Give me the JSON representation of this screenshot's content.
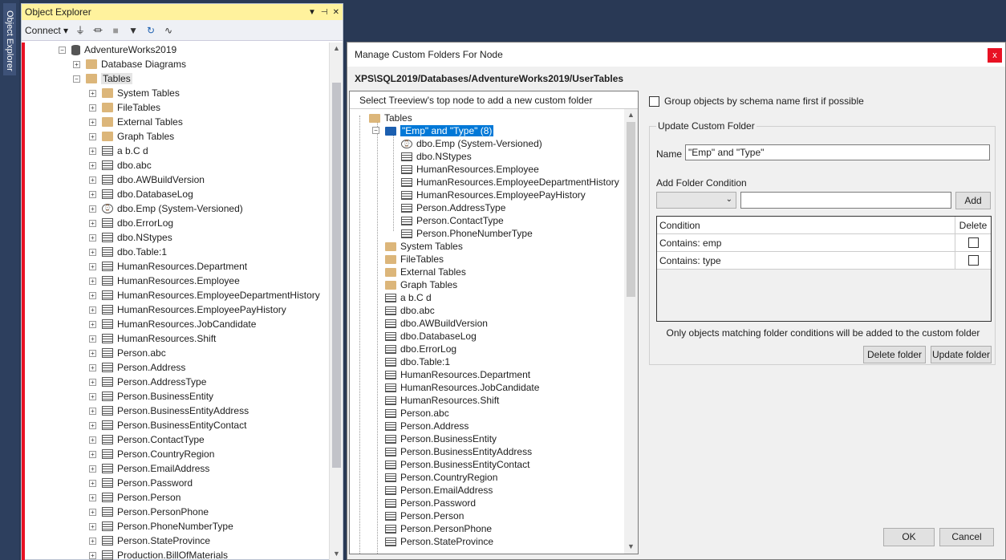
{
  "side_tab": {
    "label": "Object Explorer"
  },
  "object_explorer": {
    "title": "Object Explorer",
    "connect_label": "Connect",
    "rows": [
      {
        "label": "AdventureWorks2019",
        "indent": 1,
        "icon": "database-icon",
        "expanded": true
      },
      {
        "label": "Database Diagrams",
        "indent": 2,
        "icon": "folder-icon",
        "expanded": false
      },
      {
        "label": "Tables",
        "indent": 2,
        "icon": "folder-icon",
        "expanded": true
      },
      {
        "label": "System Tables",
        "indent": 3,
        "icon": "folder-icon",
        "expanded": false
      },
      {
        "label": "FileTables",
        "indent": 3,
        "icon": "folder-icon",
        "expanded": false
      },
      {
        "label": "External Tables",
        "indent": 3,
        "icon": "folder-icon",
        "expanded": false
      },
      {
        "label": "Graph Tables",
        "indent": 3,
        "icon": "folder-icon",
        "expanded": false
      },
      {
        "label": "a b.C d",
        "indent": 3,
        "icon": "table-icon",
        "expanded": false
      },
      {
        "label": "dbo.abc",
        "indent": 3,
        "icon": "table-icon",
        "expanded": false
      },
      {
        "label": "dbo.AWBuildVersion",
        "indent": 3,
        "icon": "table-icon",
        "expanded": false
      },
      {
        "label": "dbo.DatabaseLog",
        "indent": 3,
        "icon": "table-icon",
        "expanded": false
      },
      {
        "label": "dbo.Emp (System-Versioned)",
        "indent": 3,
        "icon": "versioned-table-icon",
        "expanded": false
      },
      {
        "label": "dbo.ErrorLog",
        "indent": 3,
        "icon": "table-icon",
        "expanded": false
      },
      {
        "label": "dbo.NStypes",
        "indent": 3,
        "icon": "table-icon",
        "expanded": false
      },
      {
        "label": "dbo.Table:1",
        "indent": 3,
        "icon": "table-icon",
        "expanded": false
      },
      {
        "label": "HumanResources.Department",
        "indent": 3,
        "icon": "table-icon",
        "expanded": false
      },
      {
        "label": "HumanResources.Employee",
        "indent": 3,
        "icon": "table-icon",
        "expanded": false
      },
      {
        "label": "HumanResources.EmployeeDepartmentHistory",
        "indent": 3,
        "icon": "table-icon",
        "expanded": false
      },
      {
        "label": "HumanResources.EmployeePayHistory",
        "indent": 3,
        "icon": "table-icon",
        "expanded": false
      },
      {
        "label": "HumanResources.JobCandidate",
        "indent": 3,
        "icon": "table-icon",
        "expanded": false
      },
      {
        "label": "HumanResources.Shift",
        "indent": 3,
        "icon": "table-icon",
        "expanded": false
      },
      {
        "label": "Person.abc",
        "indent": 3,
        "icon": "table-icon",
        "expanded": false
      },
      {
        "label": "Person.Address",
        "indent": 3,
        "icon": "table-icon",
        "expanded": false
      },
      {
        "label": "Person.AddressType",
        "indent": 3,
        "icon": "table-icon",
        "expanded": false
      },
      {
        "label": "Person.BusinessEntity",
        "indent": 3,
        "icon": "table-icon",
        "expanded": false
      },
      {
        "label": "Person.BusinessEntityAddress",
        "indent": 3,
        "icon": "table-icon",
        "expanded": false
      },
      {
        "label": "Person.BusinessEntityContact",
        "indent": 3,
        "icon": "table-icon",
        "expanded": false
      },
      {
        "label": "Person.ContactType",
        "indent": 3,
        "icon": "table-icon",
        "expanded": false
      },
      {
        "label": "Person.CountryRegion",
        "indent": 3,
        "icon": "table-icon",
        "expanded": false
      },
      {
        "label": "Person.EmailAddress",
        "indent": 3,
        "icon": "table-icon",
        "expanded": false
      },
      {
        "label": "Person.Password",
        "indent": 3,
        "icon": "table-icon",
        "expanded": false
      },
      {
        "label": "Person.Person",
        "indent": 3,
        "icon": "table-icon",
        "expanded": false
      },
      {
        "label": "Person.PersonPhone",
        "indent": 3,
        "icon": "table-icon",
        "expanded": false
      },
      {
        "label": "Person.PhoneNumberType",
        "indent": 3,
        "icon": "table-icon",
        "expanded": false
      },
      {
        "label": "Person.StateProvince",
        "indent": 3,
        "icon": "table-icon",
        "expanded": false
      },
      {
        "label": "Production.BillOfMaterials",
        "indent": 3,
        "icon": "table-icon",
        "expanded": false
      }
    ]
  },
  "dialog": {
    "title": "Manage Custom Folders For Node",
    "close_label": "x",
    "path": "XPS\\SQL2019/Databases/AdventureWorks2019/UserTables",
    "tree_header": "Select Treeview's top node to add a new custom folder",
    "tree_rows": [
      {
        "label": "Tables",
        "level": 0,
        "icon": "folder-icon",
        "selected": false
      },
      {
        "label": "\"Emp\" and \"Type\" (8)",
        "level": 1,
        "icon": "custom-folder-icon",
        "selected": true
      },
      {
        "label": "dbo.Emp (System-Versioned)",
        "level": 2,
        "icon": "versioned-table-icon",
        "selected": false
      },
      {
        "label": "dbo.NStypes",
        "level": 2,
        "icon": "table-icon",
        "selected": false
      },
      {
        "label": "HumanResources.Employee",
        "level": 2,
        "icon": "table-icon",
        "selected": false
      },
      {
        "label": "HumanResources.EmployeeDepartmentHistory",
        "level": 2,
        "icon": "table-icon",
        "selected": false
      },
      {
        "label": "HumanResources.EmployeePayHistory",
        "level": 2,
        "icon": "table-icon",
        "selected": false
      },
      {
        "label": "Person.AddressType",
        "level": 2,
        "icon": "table-icon",
        "selected": false
      },
      {
        "label": "Person.ContactType",
        "level": 2,
        "icon": "table-icon",
        "selected": false
      },
      {
        "label": "Person.PhoneNumberType",
        "level": 2,
        "icon": "table-icon",
        "selected": false
      },
      {
        "label": "System Tables",
        "level": 1,
        "icon": "folder-icon",
        "selected": false
      },
      {
        "label": "FileTables",
        "level": 1,
        "icon": "folder-icon",
        "selected": false
      },
      {
        "label": "External Tables",
        "level": 1,
        "icon": "folder-icon",
        "selected": false
      },
      {
        "label": "Graph Tables",
        "level": 1,
        "icon": "folder-icon",
        "selected": false
      },
      {
        "label": "a b.C d",
        "level": 1,
        "icon": "table-icon",
        "selected": false
      },
      {
        "label": "dbo.abc",
        "level": 1,
        "icon": "table-icon",
        "selected": false
      },
      {
        "label": "dbo.AWBuildVersion",
        "level": 1,
        "icon": "table-icon",
        "selected": false
      },
      {
        "label": "dbo.DatabaseLog",
        "level": 1,
        "icon": "table-icon",
        "selected": false
      },
      {
        "label": "dbo.ErrorLog",
        "level": 1,
        "icon": "table-icon",
        "selected": false
      },
      {
        "label": "dbo.Table:1",
        "level": 1,
        "icon": "table-icon",
        "selected": false
      },
      {
        "label": "HumanResources.Department",
        "level": 1,
        "icon": "table-icon",
        "selected": false
      },
      {
        "label": "HumanResources.JobCandidate",
        "level": 1,
        "icon": "table-icon",
        "selected": false
      },
      {
        "label": "HumanResources.Shift",
        "level": 1,
        "icon": "table-icon",
        "selected": false
      },
      {
        "label": "Person.abc",
        "level": 1,
        "icon": "table-icon",
        "selected": false
      },
      {
        "label": "Person.Address",
        "level": 1,
        "icon": "table-icon",
        "selected": false
      },
      {
        "label": "Person.BusinessEntity",
        "level": 1,
        "icon": "table-icon",
        "selected": false
      },
      {
        "label": "Person.BusinessEntityAddress",
        "level": 1,
        "icon": "table-icon",
        "selected": false
      },
      {
        "label": "Person.BusinessEntityContact",
        "level": 1,
        "icon": "table-icon",
        "selected": false
      },
      {
        "label": "Person.CountryRegion",
        "level": 1,
        "icon": "table-icon",
        "selected": false
      },
      {
        "label": "Person.EmailAddress",
        "level": 1,
        "icon": "table-icon",
        "selected": false
      },
      {
        "label": "Person.Password",
        "level": 1,
        "icon": "table-icon",
        "selected": false
      },
      {
        "label": "Person.Person",
        "level": 1,
        "icon": "table-icon",
        "selected": false
      },
      {
        "label": "Person.PersonPhone",
        "level": 1,
        "icon": "table-icon",
        "selected": false
      },
      {
        "label": "Person.StateProvince",
        "level": 1,
        "icon": "table-icon",
        "selected": false
      }
    ],
    "group_by_schema_label": "Group objects by schema name first if possible",
    "group_by_schema_checked": false,
    "update_group_title": "Update Custom Folder",
    "name_label": "Name",
    "name_value": "\"Emp\" and \"Type\"",
    "add_condition_label": "Add Folder Condition",
    "condition_dropdown_value": "",
    "condition_text_value": "",
    "add_button": "Add",
    "grid": {
      "col_condition": "Condition",
      "col_delete": "Delete",
      "rows": [
        {
          "condition": "Contains: emp",
          "delete": false
        },
        {
          "condition": "Contains: type",
          "delete": false
        }
      ]
    },
    "hint": "Only objects matching folder conditions will be added to the custom folder",
    "delete_folder_button": "Delete folder",
    "update_folder_button": "Update folder",
    "ok_button": "OK",
    "cancel_button": "Cancel"
  }
}
